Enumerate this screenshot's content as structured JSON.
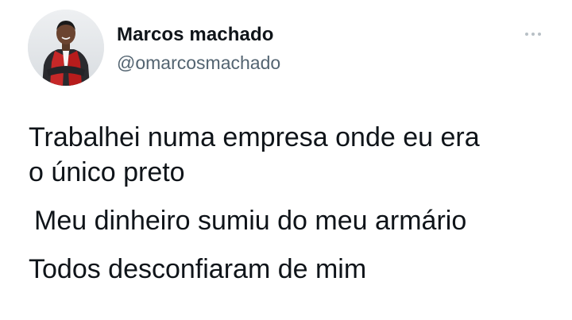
{
  "author": {
    "display_name": "Marcos machado",
    "handle": "@omarcosmachado",
    "avatar": "profile-photo"
  },
  "menu": {
    "icon": "more-options-icon"
  },
  "tweet": {
    "lines": [
      "Trabalhei numa empresa onde eu era",
      "o único preto",
      "Meu dinheiro sumiu do meu armário",
      "Todos desconfiaram de mim"
    ]
  },
  "colors": {
    "background": "#ffffff",
    "text_primary": "#0f1419",
    "text_secondary": "#536471",
    "more_icon": "#b8c0c6"
  }
}
